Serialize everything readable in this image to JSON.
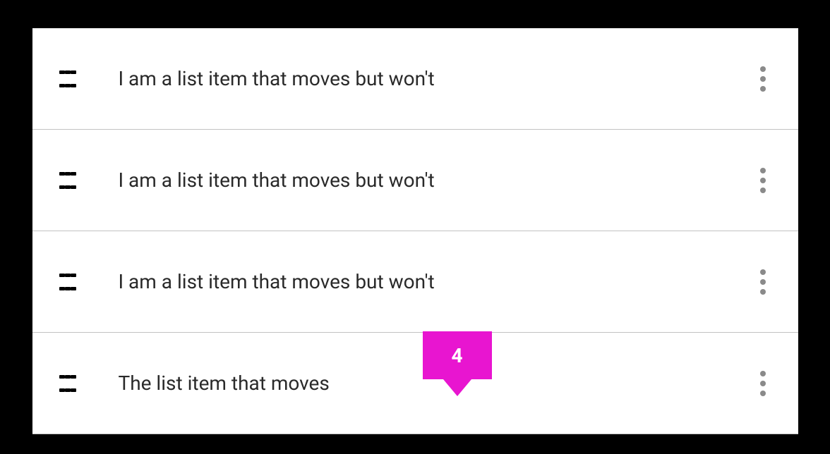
{
  "list": {
    "items": [
      {
        "label": "I am a list item that moves but won't"
      },
      {
        "label": "I am a list item that moves but won't"
      },
      {
        "label": "I am a list item that moves but won't"
      },
      {
        "label": "The list item that moves"
      }
    ]
  },
  "badge": {
    "value": "4"
  }
}
